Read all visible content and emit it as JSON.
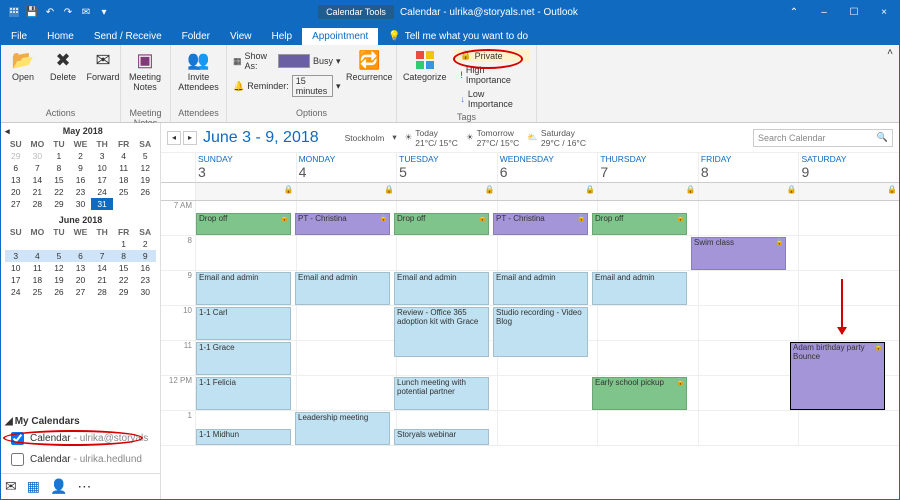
{
  "title": {
    "context_tab": "Calendar Tools",
    "text": "Calendar - ulrika@storyals.net - Outlook"
  },
  "qat": {
    "save": "save-icon",
    "undo": "undo-icon",
    "redo": "redo-icon",
    "caret": "caret-icon"
  },
  "window_controls": {
    "min": "–",
    "max": "☐",
    "close": "×"
  },
  "tabs": {
    "file": "File",
    "home": "Home",
    "send_receive": "Send / Receive",
    "folder": "Folder",
    "view": "View",
    "help": "Help",
    "appointment": "Appointment",
    "tellme": "Tell me what you want to do"
  },
  "ribbon": {
    "actions": {
      "open": "Open",
      "delete": "Delete",
      "forward": "Forward",
      "group": "Actions"
    },
    "notes": {
      "meeting_notes": "Meeting\nNotes",
      "group": "Meeting Notes"
    },
    "attendees": {
      "invite": "Invite\nAttendees",
      "group": "Attendees"
    },
    "options": {
      "show_as": "Show As:",
      "show_as_value": "Busy",
      "reminder": "Reminder:",
      "reminder_value": "15 minutes",
      "recurrence": "Recurrence",
      "group": "Options"
    },
    "tags": {
      "categorize": "Categorize",
      "private": "Private",
      "high": "High Importance",
      "low": "Low Importance",
      "group": "Tags"
    }
  },
  "minicals": {
    "may": {
      "title": "May 2018",
      "dow": [
        "SU",
        "MO",
        "TU",
        "WE",
        "TH",
        "FR",
        "SA"
      ],
      "cells": [
        "29",
        "30",
        "1",
        "2",
        "3",
        "4",
        "5",
        "6",
        "7",
        "8",
        "9",
        "10",
        "11",
        "12",
        "13",
        "14",
        "15",
        "16",
        "17",
        "18",
        "19",
        "20",
        "21",
        "22",
        "23",
        "24",
        "25",
        "26",
        "27",
        "28",
        "29",
        "30",
        "31"
      ]
    },
    "june": {
      "title": "June 2018",
      "dow": [
        "SU",
        "MO",
        "TU",
        "WE",
        "TH",
        "FR",
        "SA"
      ],
      "cells": [
        "",
        "",
        "",
        "",
        "",
        "1",
        "2",
        "3",
        "4",
        "5",
        "6",
        "7",
        "8",
        "9",
        "10",
        "11",
        "12",
        "13",
        "14",
        "15",
        "16",
        "17",
        "18",
        "19",
        "20",
        "21",
        "22",
        "23",
        "24",
        "25",
        "26",
        "27",
        "28",
        "29",
        "30"
      ]
    }
  },
  "mycalendars": {
    "header": "My Calendars",
    "items": [
      {
        "checked": true,
        "label": "Calendar",
        "suffix": "- ulrika@storyals"
      },
      {
        "checked": false,
        "label": "Calendar",
        "suffix": "- ulrika.hedlund"
      }
    ]
  },
  "calendar": {
    "range": "June 3 - 9, 2018",
    "weather": {
      "city": "Stockholm",
      "today": {
        "label": "Today",
        "temp": "21°C/ 15°C"
      },
      "tomorrow": {
        "label": "Tomorrow",
        "temp": "27°C/ 15°C"
      },
      "saturday": {
        "label": "Saturday",
        "temp": "29°C / 16°C"
      }
    },
    "search_placeholder": "Search Calendar",
    "days": [
      {
        "name": "SUNDAY",
        "num": "3"
      },
      {
        "name": "MONDAY",
        "num": "4"
      },
      {
        "name": "TUESDAY",
        "num": "5"
      },
      {
        "name": "WEDNESDAY",
        "num": "6"
      },
      {
        "name": "THURSDAY",
        "num": "7"
      },
      {
        "name": "FRIDAY",
        "num": "8"
      },
      {
        "name": "SATURDAY",
        "num": "9"
      }
    ],
    "hours": [
      "7 AM",
      "8",
      "9",
      "10",
      "11",
      "12 PM",
      "1"
    ]
  },
  "events": {
    "drop_off": "Drop off",
    "pt_christina": "PT - Christina",
    "swim": "Swim class",
    "email_admin": "Email and admin",
    "carl": "1-1 Carl",
    "grace": "1-1 Grace",
    "felicia": "1-1 Felicia",
    "midhun": "1-1 Midhun",
    "review": "Review - Office 365 adoption kit with Grace",
    "studio": "Studio recording - Video Blog",
    "lunch": "Lunch meeting with potential partner",
    "leadership": "Leadership meeting",
    "webinar": "Storyals webinar",
    "pickup": "Early school pickup",
    "birthday": "Adam birthday party Bounce"
  }
}
